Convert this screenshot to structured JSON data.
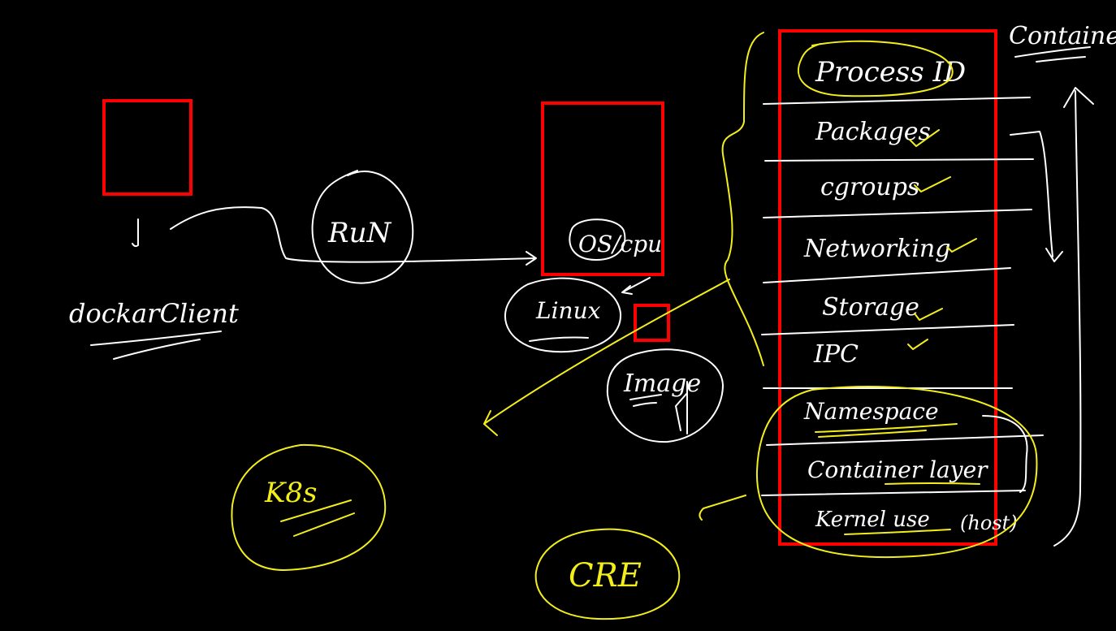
{
  "title": "Container",
  "labels": {
    "docker_client": "dockarClient",
    "run": "RuN",
    "os_cpu": "OS/cpu",
    "linux": "Linux",
    "image": "Image",
    "k8s": "K8s",
    "cre": "CRE"
  },
  "container_layers": [
    {
      "label": "Process ID"
    },
    {
      "label": "Packages"
    },
    {
      "label": "cgroups"
    },
    {
      "label": "Networking"
    },
    {
      "label": "Storage"
    },
    {
      "label": "IPC"
    },
    {
      "label": "Namespace"
    },
    {
      "label": "Container layer"
    },
    {
      "label": "Kernel use"
    }
  ],
  "kernel_note": "(host)",
  "colors": {
    "background": "#000000",
    "chalk_white": "#ffffff",
    "highlight_yellow": "#f3ee1b",
    "box_red": "#ff0000"
  }
}
